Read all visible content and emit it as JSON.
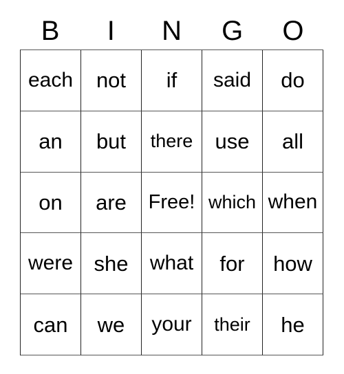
{
  "card": {
    "title": "BINGO",
    "background_color": "#ffffff",
    "text_color": "#000000",
    "border_color": "#333333"
  },
  "header": {
    "letters": [
      "B",
      "I",
      "N",
      "G",
      "O"
    ]
  },
  "grid": {
    "columns": 5,
    "rows": 5,
    "free_space": {
      "label": "Free!",
      "row": 2,
      "column": 2
    },
    "cells": [
      [
        "each",
        "not",
        "if",
        "said",
        "do"
      ],
      [
        "an",
        "but",
        "there",
        "use",
        "all"
      ],
      [
        "on",
        "are",
        "Free!",
        "which",
        "when"
      ],
      [
        "were",
        "she",
        "what",
        "for",
        "how"
      ],
      [
        "can",
        "we",
        "your",
        "their",
        "he"
      ]
    ]
  }
}
